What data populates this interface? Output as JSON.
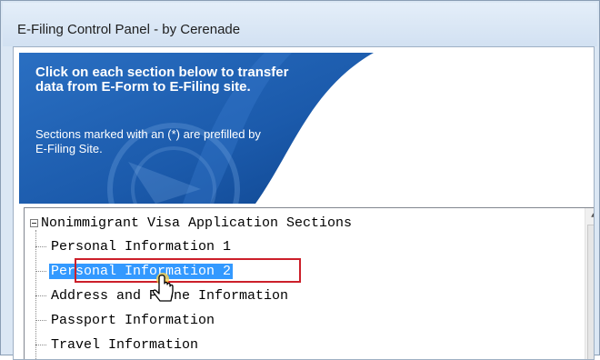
{
  "window": {
    "title": "E-Filing Control Panel - by Cerenade"
  },
  "banner": {
    "heading": "Click on each section below to transfer data from E-Form to E-Filing site.",
    "note": "Sections marked with an (*) are prefilled by E-Filing Site."
  },
  "tree": {
    "root_label": "Nonimmigrant Visa Application Sections",
    "items": [
      {
        "label": "Personal Information 1",
        "selected": false
      },
      {
        "label": "Personal Information 2",
        "selected": true
      },
      {
        "label": "Address and Phone Information",
        "selected": false
      },
      {
        "label": "Passport Information",
        "selected": false
      },
      {
        "label": "Travel Information",
        "selected": false
      }
    ]
  },
  "colors": {
    "banner_blue": "#1a5cb0",
    "selection": "#3399ff",
    "highlight_outline": "#cc1f2a"
  },
  "icons": {
    "expander": "collapse-minus-icon",
    "cursor": "hand-pointer-icon",
    "scroll_up": "arrow-up-icon"
  }
}
